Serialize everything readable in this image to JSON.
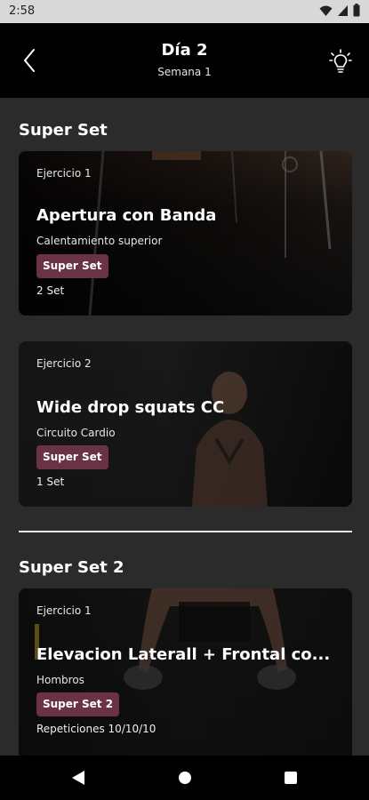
{
  "status_bar": {
    "time": "2:58"
  },
  "header": {
    "title": "Día 2",
    "subtitle": "Semana 1"
  },
  "sections": [
    {
      "title": "Super Set",
      "cards": [
        {
          "label": "Ejercicio 1",
          "title": "Apertura con Banda",
          "subtitle": "Calentamiento superior",
          "badge": "Super Set",
          "meta": "2 Set"
        },
        {
          "label": "Ejercicio 2",
          "title": "Wide drop squats CC",
          "subtitle": "Circuito Cardio",
          "badge": "Super Set",
          "meta": "1 Set"
        }
      ]
    },
    {
      "title": "Super Set 2",
      "cards": [
        {
          "label": "Ejercicio 1",
          "title": "Elevacion Laterall + Frontal co...",
          "subtitle": "Hombros",
          "badge": "Super Set 2",
          "meta": "Repeticiones 10/10/10"
        }
      ]
    }
  ],
  "colors": {
    "badge": "#6a3345",
    "background": "#2b2b2b",
    "header": "#000000"
  },
  "icons": {
    "back": "chevron-left-icon",
    "tip": "lightbulb-icon",
    "nav_back": "triangle-back-icon",
    "nav_home": "circle-home-icon",
    "nav_recents": "square-recents-icon"
  }
}
